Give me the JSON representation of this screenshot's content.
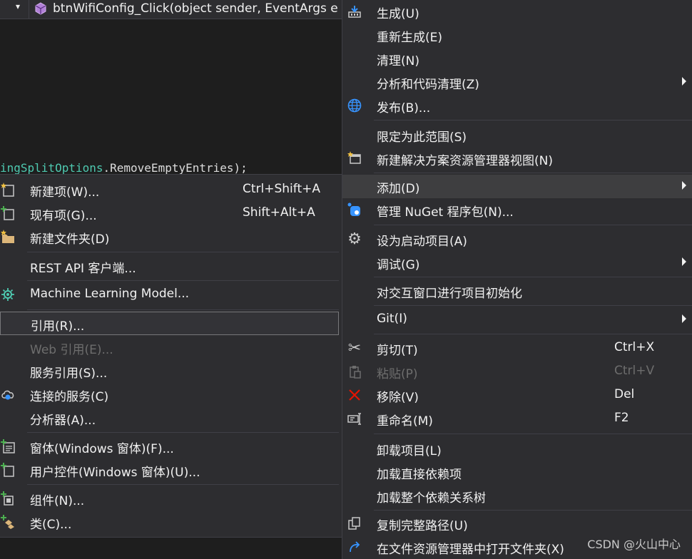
{
  "editor": {
    "nav_caret": "▾",
    "nav_method": "btnWifiConfig_Click(object sender, EventArgs e",
    "code_prefix": "ingSplitOptions",
    "code_suffix": ".RemoveEmptyEntries);"
  },
  "context_menu": {
    "build": "生成(U)",
    "rebuild": "重新生成(E)",
    "clean": "清理(N)",
    "analyze": "分析和代码清理(Z)",
    "publish": "发布(B)...",
    "scope": "限定为此范围(S)",
    "new_view": "新建解决方案资源管理器视图(N)",
    "add": "添加(D)",
    "nuget": "管理 NuGet 程序包(N)...",
    "startup": "设为启动项目(A)",
    "debug": "调试(G)",
    "interactive": "对交互窗口进行项目初始化",
    "git": "Git(I)",
    "cut": "剪切(T)",
    "cut_shortcut": "Ctrl+X",
    "paste": "粘贴(P)",
    "paste_shortcut": "Ctrl+V",
    "remove": "移除(V)",
    "remove_shortcut": "Del",
    "rename": "重命名(M)",
    "rename_shortcut": "F2",
    "unload": "卸载项目(L)",
    "load_direct": "加载直接依赖项",
    "load_tree": "加载整个依赖关系树",
    "copy_path": "复制完整路径(U)",
    "open_folder": "在文件资源管理器中打开文件夹(X)"
  },
  "add_submenu": {
    "new_item": "新建项(W)...",
    "new_item_shortcut": "Ctrl+Shift+A",
    "existing_item": "现有项(G)...",
    "existing_item_shortcut": "Shift+Alt+A",
    "new_folder": "新建文件夹(D)",
    "rest_api": "REST API 客户端...",
    "ml_model": "Machine Learning Model...",
    "reference": "引用(R)...",
    "web_reference": "Web 引用(E)...",
    "service_reference": "服务引用(S)...",
    "connected_service": "连接的服务(C)",
    "analyzer": "分析器(A)...",
    "windows_form": "窗体(Windows 窗体)(F)...",
    "user_control": "用户控件(Windows 窗体)(U)...",
    "component": "组件(N)...",
    "class": "类(C)..."
  },
  "watermark": "CSDN @火山中心",
  "colors": {
    "accent": "#3e3e40",
    "menu_bg": "#2d2d30",
    "disabled": "#6d6d6d",
    "icon_blue": "#3794ff",
    "icon_red": "#e51400"
  }
}
